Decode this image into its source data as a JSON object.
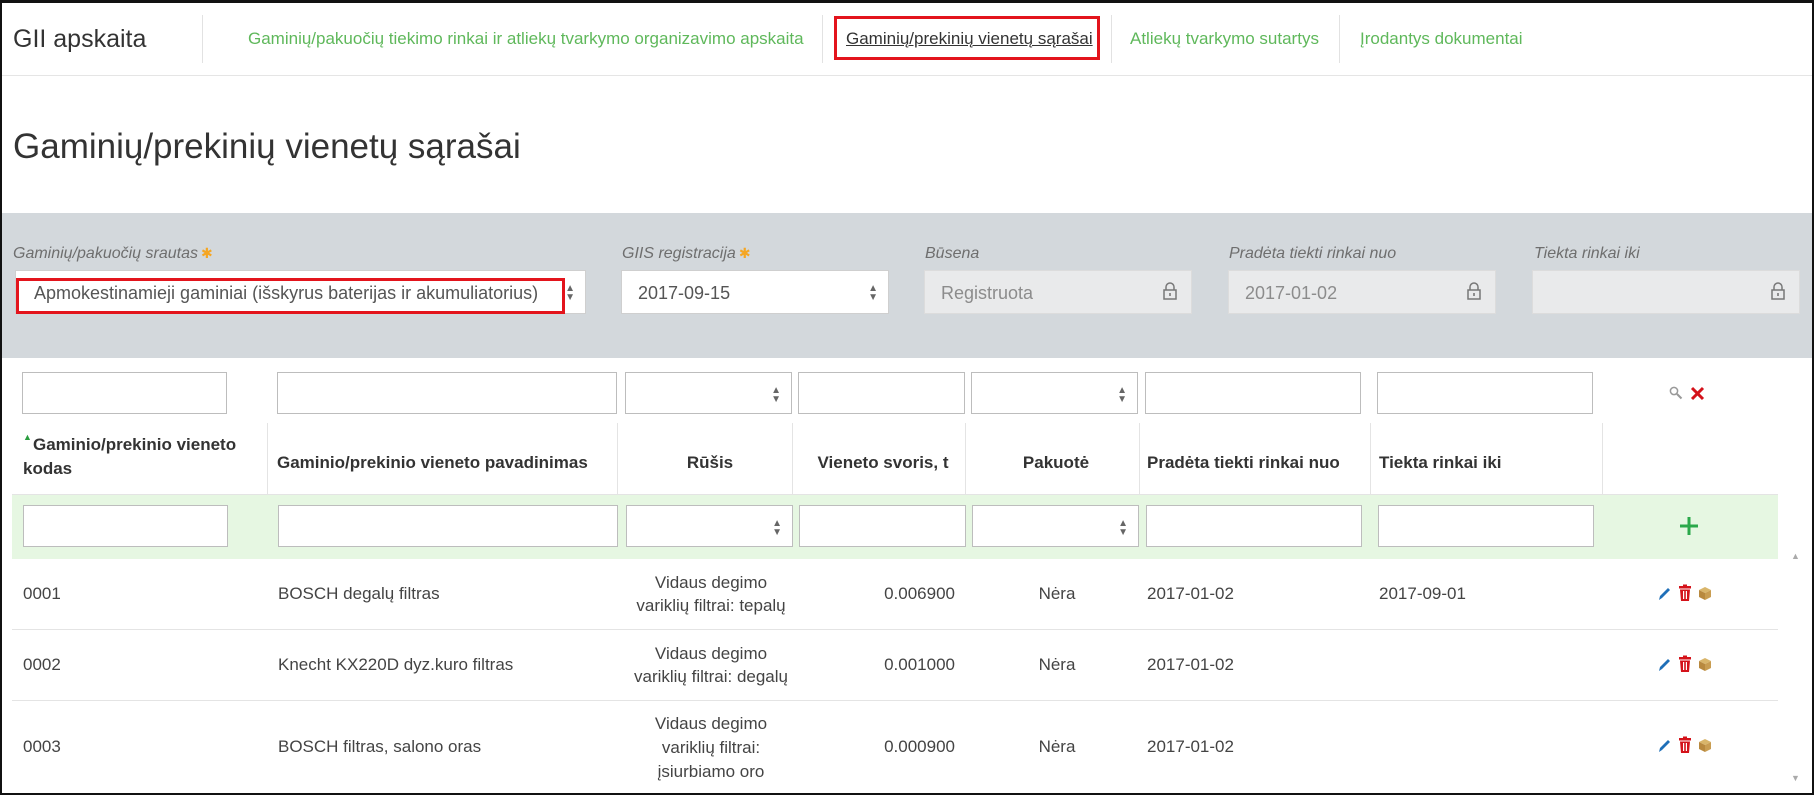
{
  "app": {
    "title": "GII apskaita"
  },
  "nav": [
    {
      "label": "Gaminių/pakuočių tiekimo rinkai ir atliekų tvarkymo organizavimo apskaita"
    },
    {
      "label": "Gaminių/prekinių vienetų sąrašai"
    },
    {
      "label": "Atliekų tvarkymo sutartys"
    },
    {
      "label": "Įrodantys dokumentai"
    }
  ],
  "page": {
    "title": "Gaminių/prekinių vienetų sąrašai"
  },
  "filters": {
    "stream": {
      "label": "Gaminių/pakuočių srautas",
      "value": "Apmokestinamieji gaminiai (išskyrus baterijas ir akumuliatorius)"
    },
    "registration": {
      "label": "GIIS registracija",
      "value": "2017-09-15"
    },
    "status": {
      "label": "Būsena",
      "value": "Registruota"
    },
    "supply_from": {
      "label": "Pradėta tiekti rinkai nuo",
      "value": "2017-01-02"
    },
    "supply_to": {
      "label": "Tiekta rinkai iki",
      "value": ""
    }
  },
  "table": {
    "columns": [
      "Gaminio/prekinio vieneto kodas",
      "Gaminio/prekinio vieneto pavadinimas",
      "Rūšis",
      "Vieneto svoris, t",
      "Pakuotė",
      "Pradėta tiekti rinkai nuo",
      "Tiekta rinkai iki"
    ],
    "rows": [
      {
        "code": "0001",
        "name": "BOSCH degalų filtras",
        "type": [
          "Vidaus degimo",
          "variklių filtrai: tepalų"
        ],
        "weight": "0.006900",
        "package": "Nėra",
        "from": "2017-01-02",
        "to": "2017-09-01"
      },
      {
        "code": "0002",
        "name": "Knecht KX220D dyz.kuro filtras",
        "type": [
          "Vidaus degimo",
          "variklių filtrai: degalų"
        ],
        "weight": "0.001000",
        "package": "Nėra",
        "from": "2017-01-02",
        "to": ""
      },
      {
        "code": "0003",
        "name": "BOSCH filtras, salono oras",
        "type": [
          "Vidaus degimo",
          "variklių filtrai:",
          "įsiurbiamo oro"
        ],
        "weight": "0.000900",
        "package": "Nėra",
        "from": "2017-01-02",
        "to": ""
      }
    ]
  },
  "colors": {
    "accent_green": "#5fb85b",
    "highlight_red": "#e3141c",
    "filter_bg": "#d3d8dc",
    "add_row_bg": "#e6f7e2"
  }
}
